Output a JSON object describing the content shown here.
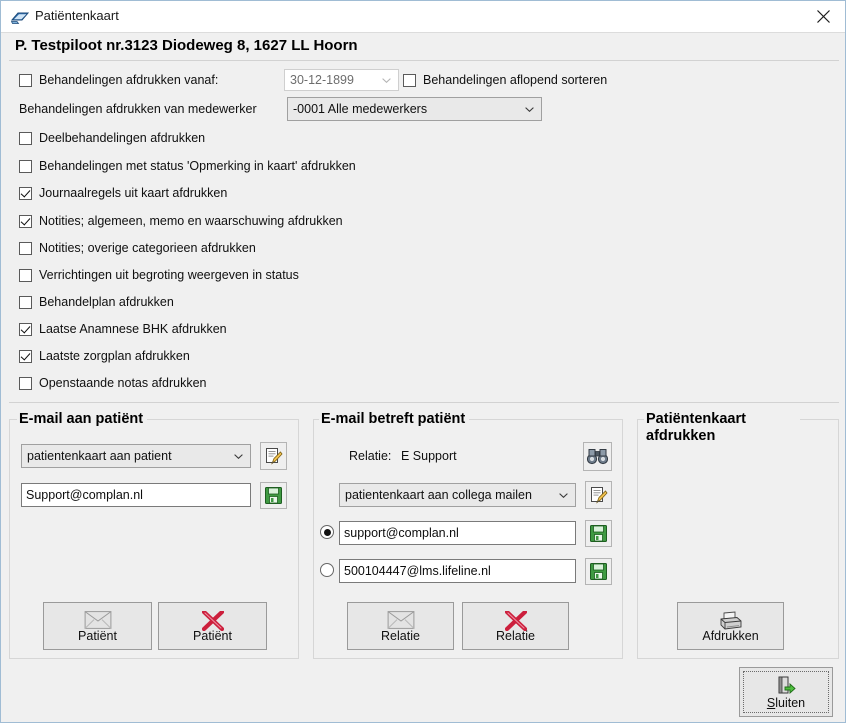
{
  "window": {
    "title": "Patiëntenkaart",
    "title_icon": "app-window-icon",
    "close_icon": "close-icon",
    "patient_header": "P. Testpiloot nr.3123 Diodeweg 8, 1627 LL Hoorn"
  },
  "options": {
    "print_from_date": {
      "label": "Behandelingen afdrukken vanaf:",
      "checked": false,
      "date_value": "30-12-1899",
      "date_enabled": false
    },
    "sort_descending": {
      "label": "Behandelingen aflopend sorteren",
      "checked": false
    },
    "employee_label": "Behandelingen afdrukken van medewerker",
    "employee_value": "-0001 Alle medewerkers",
    "checkboxes": [
      {
        "label": "Deelbehandelingen afdrukken",
        "checked": false
      },
      {
        "label": "Behandelingen met status 'Opmerking in kaart' afdrukken",
        "checked": false
      },
      {
        "label": "Journaalregels uit kaart afdrukken",
        "checked": true
      },
      {
        "label": "Notities;  algemeen,  memo en waarschuwing afdrukken",
        "checked": true
      },
      {
        "label": "Notities; overige categorieen afdrukken",
        "checked": false
      },
      {
        "label": "Verrichtingen uit  begroting weergeven  in status",
        "checked": false
      },
      {
        "label": "Behandelplan afdrukken",
        "checked": false
      },
      {
        "label": "Laatse Anamnese BHK afdrukken",
        "checked": true
      },
      {
        "label": "Laatste zorgplan afdrukken",
        "checked": true
      },
      {
        "label": "Openstaande notas afdrukken",
        "checked": false
      }
    ]
  },
  "email_patient": {
    "title": "E-mail aan patiënt",
    "template_value": "patientenkaart aan patient",
    "edit_icon": "notepad-pencil-icon",
    "address_value": "Support@complan.nl",
    "save_icon": "floppy-disk-save-icon",
    "send_button": {
      "label": "Patiënt",
      "icon": "envelope-icon"
    },
    "cancel_button": {
      "label": "Patiënt",
      "icon": "red-x-icon"
    }
  },
  "email_relation": {
    "title": "E-mail betreft patiënt",
    "relation_label": "Relatie:",
    "relation_value": "E Support",
    "search_icon": "binoculars-icon",
    "template_value": "patientenkaart aan collega mailen",
    "edit_icon": "notepad-pencil-icon",
    "addresses": [
      {
        "value": "support@complan.nl",
        "selected": true,
        "save_icon": "floppy-disk-save-icon"
      },
      {
        "value": "500104447@lms.lifeline.nl",
        "selected": false,
        "save_icon": "floppy-disk-save-icon"
      }
    ],
    "send_button": {
      "label": "Relatie",
      "icon": "envelope-icon"
    },
    "cancel_button": {
      "label": "Relatie",
      "icon": "red-x-icon"
    }
  },
  "print_panel": {
    "title": "Patiëntenkaart\nafdrukken",
    "print_button": {
      "label": "Afdrukken",
      "icon": "printer-icon"
    }
  },
  "footer": {
    "close_button": {
      "label_accel": "S",
      "label_rest": "luiten",
      "icon": "exit-door-icon"
    }
  },
  "colors": {
    "window_background": "#f0f0f0",
    "titlebar_background": "#ffffff",
    "window_border": "#a0bcd4",
    "save_icon_green": "#3f9a42",
    "cancel_red": "#cc1f3c"
  }
}
